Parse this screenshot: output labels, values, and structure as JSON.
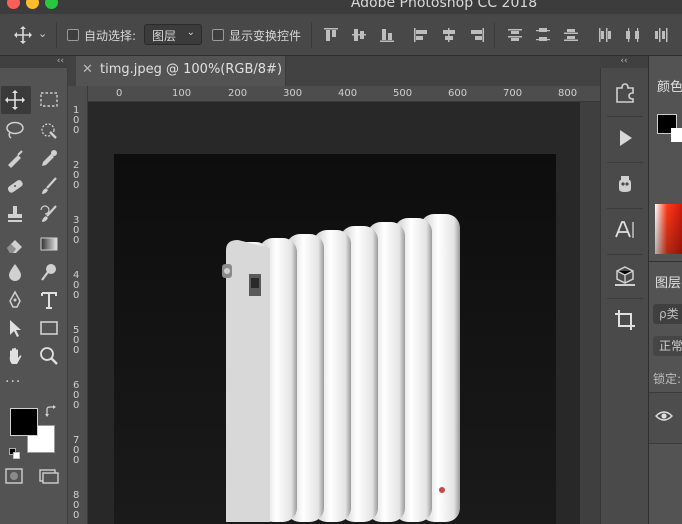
{
  "app": {
    "title": "Adobe Photoshop CC 2018"
  },
  "options_bar": {
    "auto_select_label": "自动选择:",
    "auto_select_target": "图层",
    "show_transform_label": "显示变换控件"
  },
  "document": {
    "tab_title": "timg.jpeg @ 100%(RGB/8#)"
  },
  "rulers": {
    "top_ticks": [
      "0",
      "100",
      "200",
      "300",
      "400",
      "500",
      "600",
      "700",
      "800"
    ],
    "left_ticks": [
      "1\n0\n0",
      "2\n0\n0",
      "3\n0\n0",
      "4\n0\n0",
      "5\n0\n0",
      "6\n0\n0",
      "7\n0\n0",
      "8\n0\n0"
    ]
  },
  "tools_panel": {
    "collapse_glyph": "‹‹",
    "more_tools": "···"
  },
  "right_dock": {
    "collapse_glyph": "‹‹"
  },
  "color_panel": {
    "title": "颜色"
  },
  "layers_panel": {
    "title": "图层",
    "search_placeholder": "ρ类",
    "blend_mode": "正常",
    "lock_label": "锁定:"
  },
  "colors": {
    "foreground": "#000000",
    "background": "#ffffff",
    "canvas_bg": "#282828",
    "photo_bg": "#0d0d0d"
  }
}
